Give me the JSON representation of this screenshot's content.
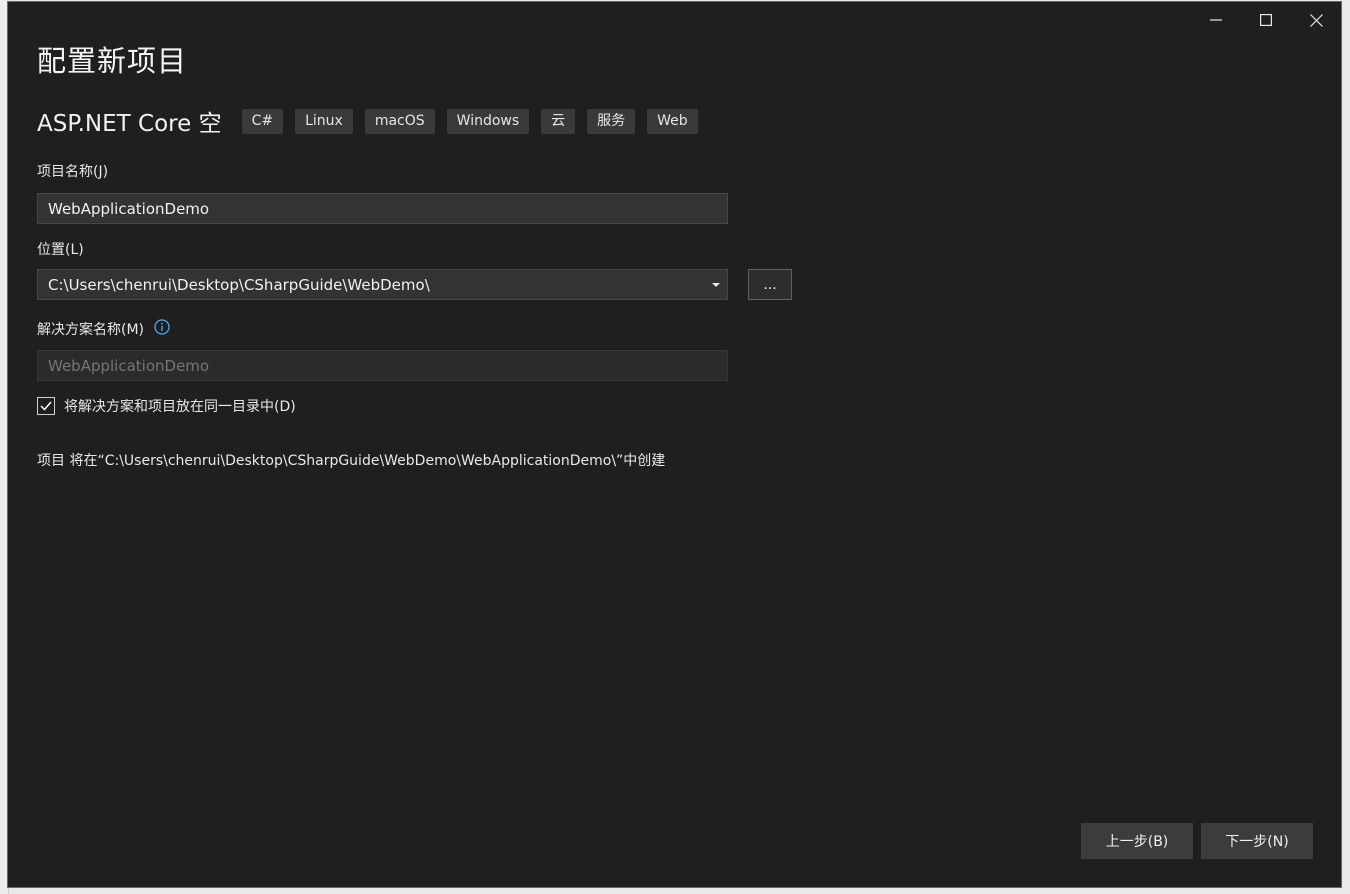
{
  "dialog": {
    "title": "配置新项目",
    "template_name": "ASP.NET Core 空",
    "tags": [
      "C#",
      "Linux",
      "macOS",
      "Windows",
      "云",
      "服务",
      "Web"
    ]
  },
  "form": {
    "project_name": {
      "label": "项目名称(J)",
      "value": "WebApplicationDemo"
    },
    "location": {
      "label": "位置(L)",
      "value": "C:\\Users\\chenrui\\Desktop\\CSharpGuide\\WebDemo\\",
      "browse_label": "..."
    },
    "solution_name": {
      "label": "解决方案名称(M)",
      "placeholder": "WebApplicationDemo"
    },
    "same_directory": {
      "label": "将解决方案和项目放在同一目录中(D)",
      "checked": true
    },
    "path_info": "项目 将在“C:\\Users\\chenrui\\Desktop\\CSharpGuide\\WebDemo\\WebApplicationDemo\\”中创建"
  },
  "footer": {
    "back_label": "上一步(B)",
    "next_label": "下一步(N)"
  },
  "colors": {
    "background": "#1f1f1f",
    "input_bg": "#333333",
    "tag_bg": "#3a3a3a",
    "button_bg": "#3c3c3c",
    "info_icon": "#4fa6ff",
    "window_border": "#6b5b8e"
  },
  "icons": {
    "minimize": "minimize-icon",
    "maximize": "maximize-icon",
    "close": "close-icon",
    "info": "info-icon",
    "dropdown": "chevron-down-icon",
    "check": "checkmark-icon"
  }
}
